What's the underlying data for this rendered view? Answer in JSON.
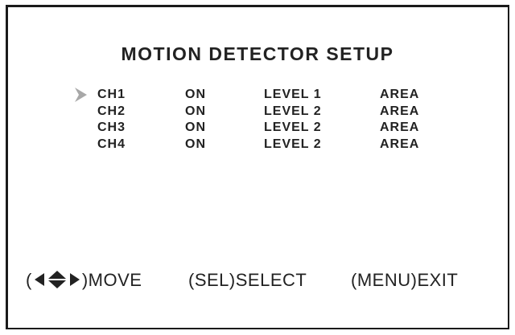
{
  "title": "MOTION DETECTOR SETUP",
  "rows": [
    {
      "channel": "CH1",
      "state": "ON",
      "level": "LEVEL 1",
      "area": "AREA",
      "selected": true
    },
    {
      "channel": "CH2",
      "state": "ON",
      "level": "LEVEL 2",
      "area": "AREA",
      "selected": false
    },
    {
      "channel": "CH3",
      "state": "ON",
      "level": "LEVEL 2",
      "area": "AREA",
      "selected": false
    },
    {
      "channel": "CH4",
      "state": "ON",
      "level": "LEVEL 2",
      "area": "AREA",
      "selected": false
    }
  ],
  "footer": {
    "move": {
      "open": "(",
      "close": ")",
      "label": "MOVE",
      "icon": "four-way-arrows-icon"
    },
    "select": {
      "key": "(SEL)",
      "label": "SELECT"
    },
    "exit": {
      "key": "(MENU)",
      "label": "EXIT"
    }
  },
  "colors": {
    "text": "#222222",
    "cursor": "#a8a8a8",
    "border": "#1a1a1a",
    "background": "#ffffff"
  }
}
